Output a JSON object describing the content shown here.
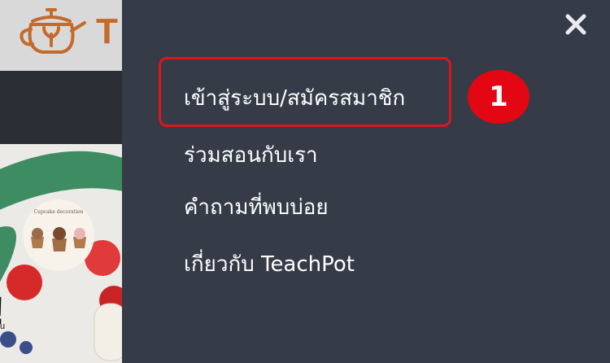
{
  "background_page": {
    "logo_letter": "T",
    "banner_headline": "!",
    "banner_subtext": "u",
    "card_label": "Cupcake decoration"
  },
  "menu": {
    "close_label": "×",
    "items": [
      {
        "label": "เข้าสู่ระบบ/สมัครสมาชิก"
      },
      {
        "label": "ร่วมสอนกับเรา"
      },
      {
        "label": "คำถามที่พบบ่อย"
      },
      {
        "label": "เกี่ยวกับ TeachPot"
      }
    ]
  },
  "annotation": {
    "step_number": "1"
  },
  "colors": {
    "menu_bg": "#353c48",
    "highlight": "#e0141c",
    "badge": "#e30613",
    "brand": "#c46a2b"
  }
}
